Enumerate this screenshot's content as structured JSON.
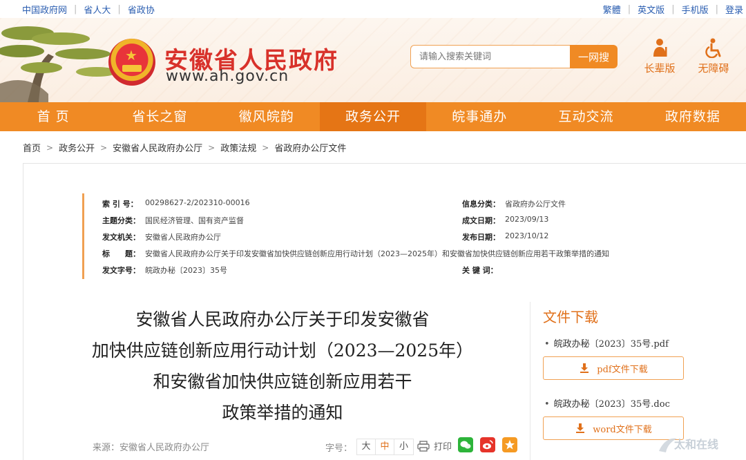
{
  "topbar": {
    "left": [
      "中国政府网",
      "省人大",
      "省政协"
    ],
    "right": [
      "繁體",
      "英文版",
      "手机版",
      "登录"
    ]
  },
  "header": {
    "site_title": "安徽省人民政府",
    "site_url": "www.ah.gov.cn",
    "search_placeholder": "请输入搜索关键词",
    "search_button": "一网搜",
    "tools": [
      "长辈版",
      "无障碍"
    ]
  },
  "nav": {
    "items": [
      "首 页",
      "省长之窗",
      "徽风皖韵",
      "政务公开",
      "皖事通办",
      "互动交流",
      "政府数据"
    ],
    "active": "政务公开"
  },
  "breadcrumb": [
    "首页",
    "政务公开",
    "安徽省人民政府办公厅",
    "政策法规",
    "省政府办公厅文件"
  ],
  "meta": {
    "index_label": "索 引 号：",
    "index_value": "00298627-2/202310-00016",
    "category_label": "信息分类：",
    "category_value": "省政府办公厅文件",
    "theme_label": "主题分类：",
    "theme_value": "国民经济管理、国有资产监督",
    "created_label": "成文日期：",
    "created_value": "2023/09/13",
    "issuer_label": "发文机关：",
    "issuer_value": "安徽省人民政府办公厅",
    "published_label": "发布日期：",
    "published_value": "2023/10/12",
    "title_label": "标　　题：",
    "title_value": "安徽省人民政府办公厅关于印发安徽省加快供应链创新应用行动计划（2023—2025年）和安徽省加快供应链创新应用若干政策举措的通知",
    "docno_label": "发文字号：",
    "docno_value": "皖政办秘〔2023〕35号",
    "keywords_label": "关 键 词："
  },
  "article": {
    "title_lines": [
      "安徽省人民政府办公厅关于印发安徽省",
      "加快供应链创新应用行动计划（2023—2025年）",
      "和安徽省加快供应链创新应用若干",
      "政策举措的通知"
    ],
    "source": "来源：安徽省人民政府办公厅",
    "font_size_label": "字号：",
    "font_sizes": [
      "大",
      "中",
      "小"
    ],
    "print_label": "打印"
  },
  "downloads": {
    "title": "文件下载",
    "files": [
      {
        "name": "皖政办秘〔2023〕35号.pdf",
        "button": "pdf文件下载"
      },
      {
        "name": "皖政办秘〔2023〕35号.doc",
        "button": "word文件下载"
      }
    ]
  },
  "colors": {
    "accent": "#f08a24",
    "title_red": "#d8312a",
    "link_blue": "#2a5db0"
  },
  "watermark": {
    "text": "太和在线"
  }
}
